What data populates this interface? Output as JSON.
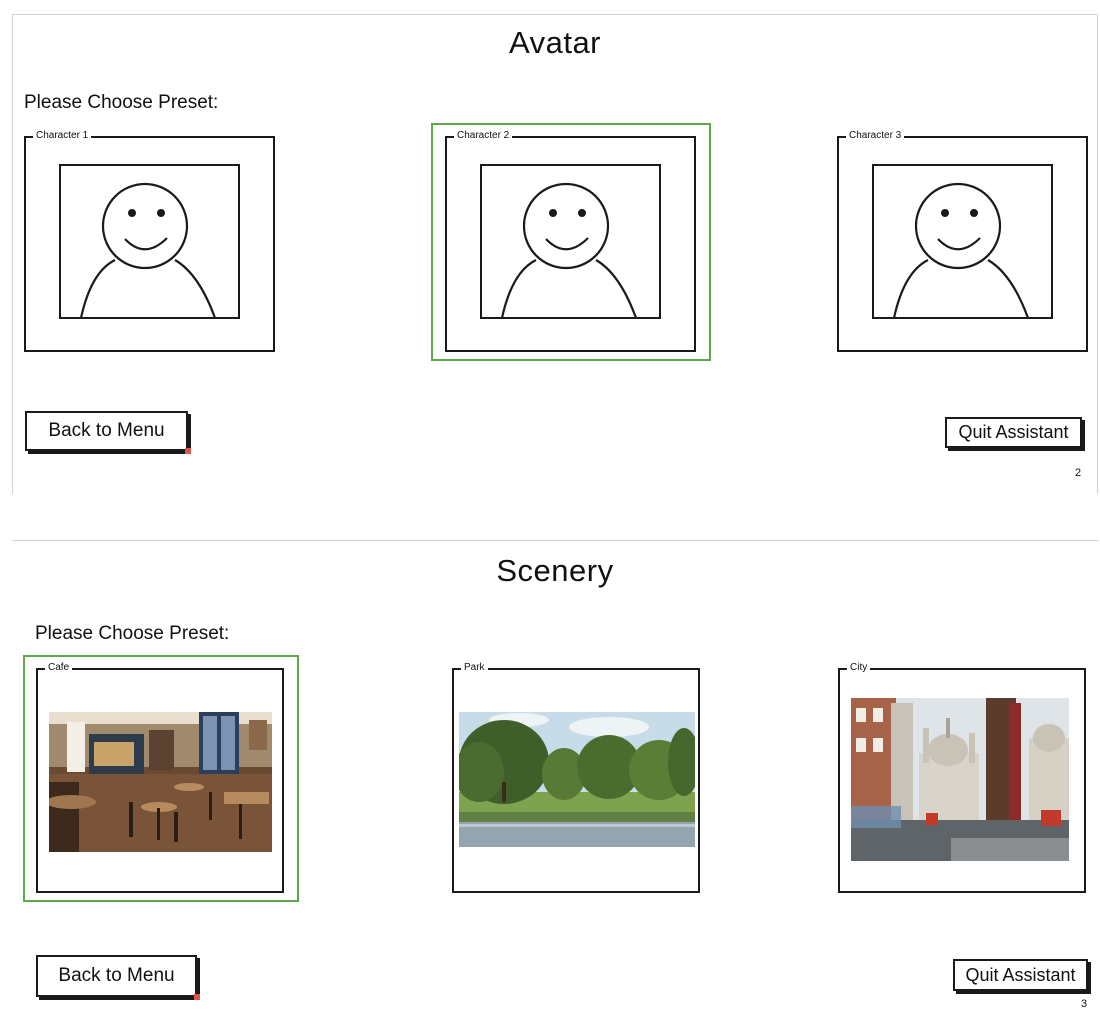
{
  "avatar_screen": {
    "title": "Avatar",
    "prompt": "Please Choose Preset:",
    "presets": [
      {
        "label": "Character 1"
      },
      {
        "label": "Character 2"
      },
      {
        "label": "Character 3"
      }
    ],
    "selected_preset": "Character 2",
    "back_label": "Back to Menu",
    "quit_label": "Quit Assistant",
    "page_number": "2"
  },
  "scenery_screen": {
    "title": "Scenery",
    "prompt": "Please Choose Preset:",
    "presets": [
      {
        "label": "Cafe",
        "image_icon": "cafe-photo"
      },
      {
        "label": "Park",
        "image_icon": "park-photo"
      },
      {
        "label": "City",
        "image_icon": "city-photo"
      }
    ],
    "selected_preset": "Cafe",
    "back_label": "Back to Menu",
    "quit_label": "Quit Assistant",
    "page_number": "3"
  },
  "colors": {
    "selection": "#5fa84a",
    "stroke": "#1a1a1a",
    "corner_marker": "#d9534f"
  }
}
